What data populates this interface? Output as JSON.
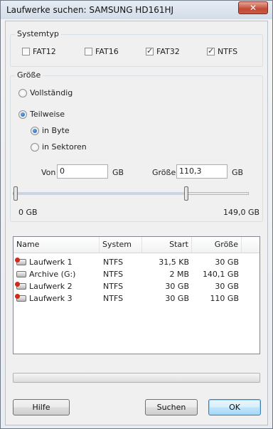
{
  "window": {
    "title": "Laufwerke suchen: SAMSUNG HD161HJ",
    "close_glyph": "✕"
  },
  "systemtyp": {
    "legend": "Systemtyp",
    "options": [
      {
        "label": "FAT12",
        "checked": false
      },
      {
        "label": "FAT16",
        "checked": false
      },
      {
        "label": "FAT32",
        "checked": true
      },
      {
        "label": "NTFS",
        "checked": true
      }
    ]
  },
  "groesse": {
    "legend": "Größe",
    "full_label": "Vollständig",
    "partial_label": "Teilweise",
    "byte_label": "in Byte",
    "sector_label": "in Sektoren",
    "selected_mode": "Teilweise",
    "selected_unit": "in Byte",
    "von_label": "Von",
    "von_value": "0",
    "von_unit": "GB",
    "size_label": "Größe",
    "size_value": "110,3",
    "size_unit": "GB",
    "slider_min_label": "0 GB",
    "slider_max_label": "149,0 GB",
    "slider_start_gb": 0,
    "slider_end_gb": 110.3
  },
  "list": {
    "columns": [
      "Name",
      "System",
      "Start",
      "Größe"
    ],
    "rows": [
      {
        "icon": "drive-error-icon",
        "name": "Laufwerk 1",
        "system": "NTFS",
        "start": "31,5 KB",
        "size": "30 GB"
      },
      {
        "icon": "drive-icon",
        "name": "Archive (G:)",
        "system": "NTFS",
        "start": "2 MB",
        "size": "140,1 GB"
      },
      {
        "icon": "drive-error-icon",
        "name": "Laufwerk 2",
        "system": "NTFS",
        "start": "30 GB",
        "size": "30 GB"
      },
      {
        "icon": "drive-error-icon",
        "name": "Laufwerk 3",
        "system": "NTFS",
        "start": "30 GB",
        "size": "110 GB"
      }
    ]
  },
  "progress": {
    "value": 0
  },
  "buttons": {
    "help": "Hilfe",
    "search": "Suchen",
    "ok": "OK"
  }
}
